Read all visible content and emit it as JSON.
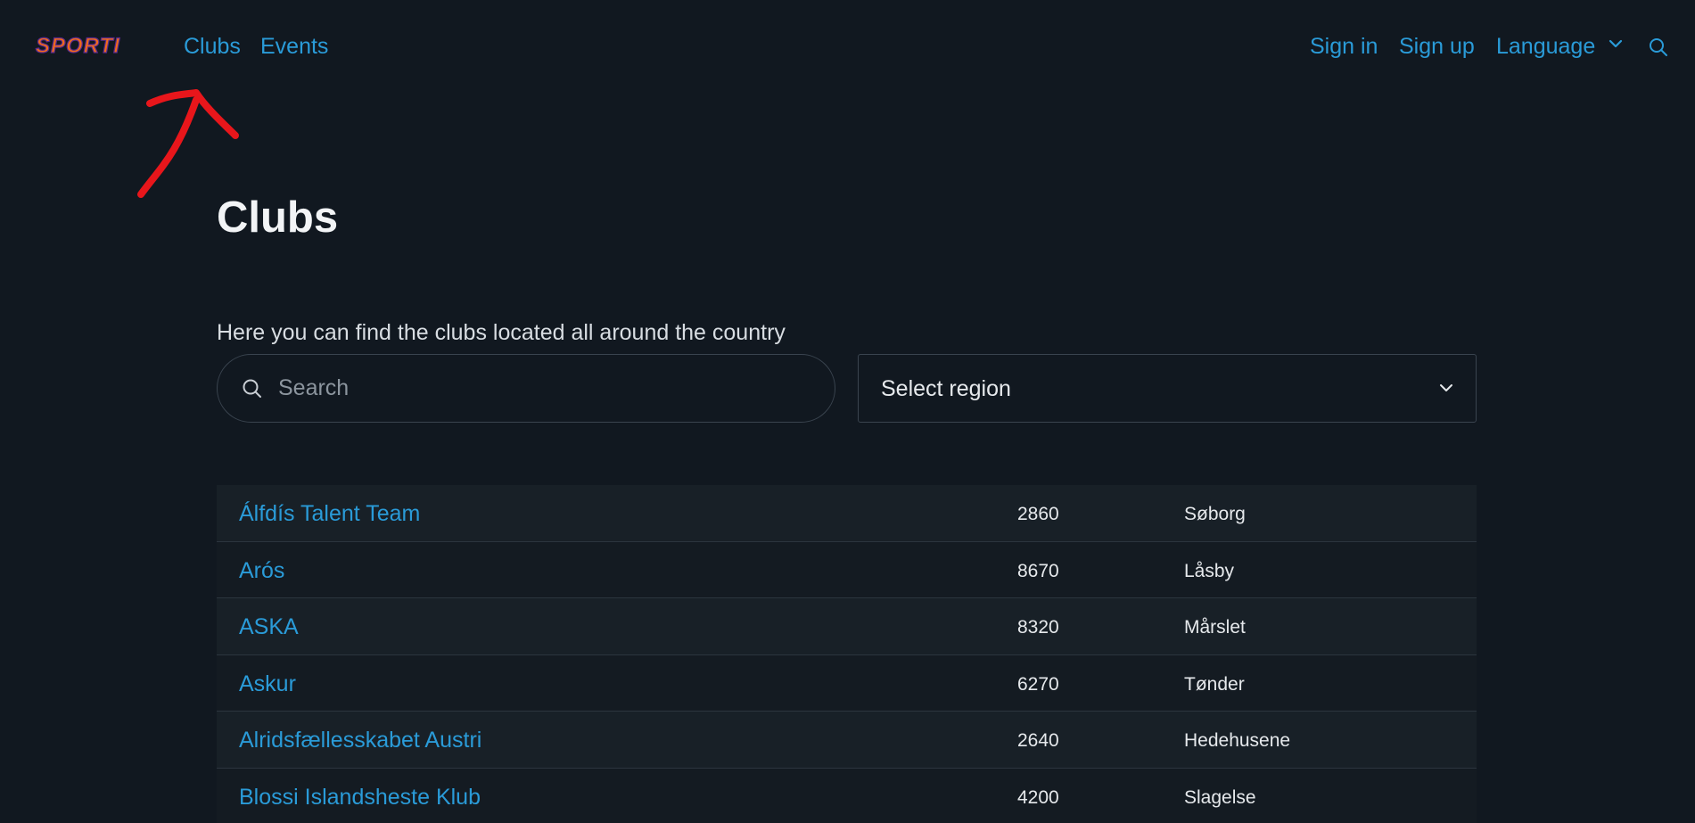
{
  "brand": {
    "logo_text": "SPORTI"
  },
  "nav": {
    "clubs": "Clubs",
    "events": "Events",
    "sign_in": "Sign in",
    "sign_up": "Sign up",
    "language": "Language"
  },
  "page": {
    "title": "Clubs",
    "intro": "Here you can find the clubs located all around the country"
  },
  "search": {
    "placeholder": "Search",
    "value": ""
  },
  "region": {
    "label": "Select region"
  },
  "clubs": [
    {
      "name": "Álfdís Talent Team",
      "zip": "2860",
      "city": "Søborg"
    },
    {
      "name": "Arós",
      "zip": "8670",
      "city": "Låsby"
    },
    {
      "name": "ASKA",
      "zip": "8320",
      "city": "Mårslet"
    },
    {
      "name": "Askur",
      "zip": "6270",
      "city": "Tønder"
    },
    {
      "name": "Alridsfællesskabet Austri",
      "zip": "2640",
      "city": "Hedehusene"
    },
    {
      "name": "Blossi Islandsheste Klub",
      "zip": "4200",
      "city": "Slagelse"
    }
  ],
  "colors": {
    "background": "#111820",
    "link": "#2a9bd8",
    "logo_fill": "#f26a1b",
    "logo_outline": "#5a2a8c",
    "annotation": "#e8161b"
  },
  "icons": {
    "language_chevron": "chevron-down-icon",
    "nav_search": "search-icon",
    "region_chevron": "chevron-down-icon"
  }
}
